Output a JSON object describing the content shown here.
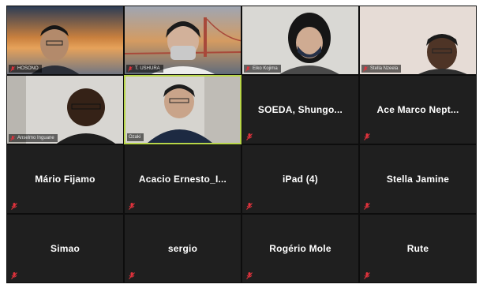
{
  "participants": [
    {
      "name": "HOSONO"
    },
    {
      "name": "T. USHURA"
    },
    {
      "name": "Eiko Kojima"
    },
    {
      "name": "Stella Nzeela"
    },
    {
      "name": "Anselmo Inguane"
    },
    {
      "name": "Ozaki"
    },
    {
      "name": "SOEDA,  Shungo..."
    },
    {
      "name": "Ace  Marco  Nept..."
    },
    {
      "name": "Mário Fijamo"
    },
    {
      "name": "Acacio  Ernesto_I..."
    },
    {
      "name": "iPad (4)"
    },
    {
      "name": "Stella Jamine"
    },
    {
      "name": "Simao"
    },
    {
      "name": "sergio"
    },
    {
      "name": "Rogério Mole"
    },
    {
      "name": "Rute"
    }
  ],
  "colors": {
    "tile_bg": "#1f1f1f",
    "active_speaker_border": "#b9d64a",
    "muted_icon": "#e0323c"
  },
  "icons": {
    "mute": "microphone-muted-icon"
  }
}
